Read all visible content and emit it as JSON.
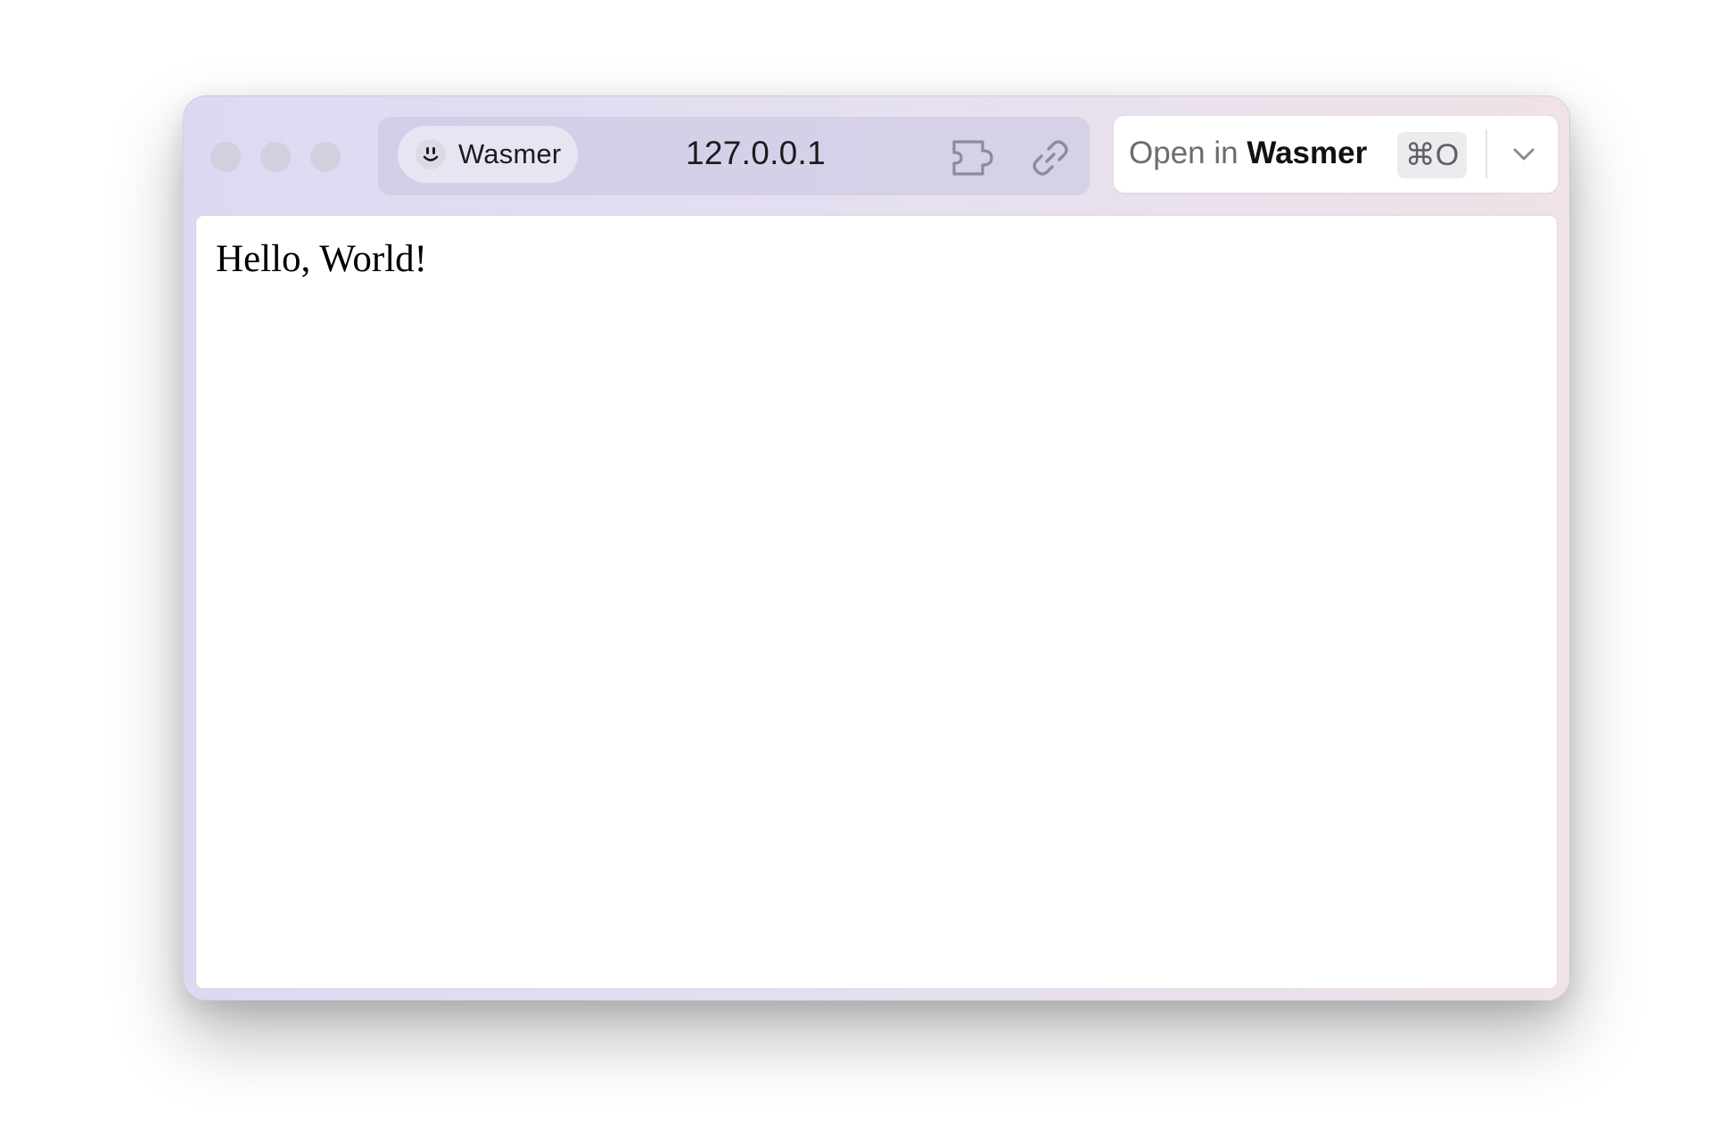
{
  "window": {
    "traffic_lights": [
      "close",
      "minimize",
      "zoom"
    ]
  },
  "toolbar": {
    "site": {
      "name": "Wasmer",
      "icon": "smiley-icon"
    },
    "url": "127.0.0.1",
    "icons": [
      "extension-icon",
      "link-icon"
    ],
    "open_in": {
      "prefix": "Open in",
      "app": "Wasmer",
      "shortcut": "⌘O",
      "menu_icon": "chevron-down-icon"
    }
  },
  "page": {
    "text": "Hello, World!"
  },
  "colors": {
    "window_bg_start": "#dcdaf3",
    "window_bg_end": "#efe2e8",
    "traffic_light": "#d2cfdf",
    "content_bg": "#ffffff"
  }
}
